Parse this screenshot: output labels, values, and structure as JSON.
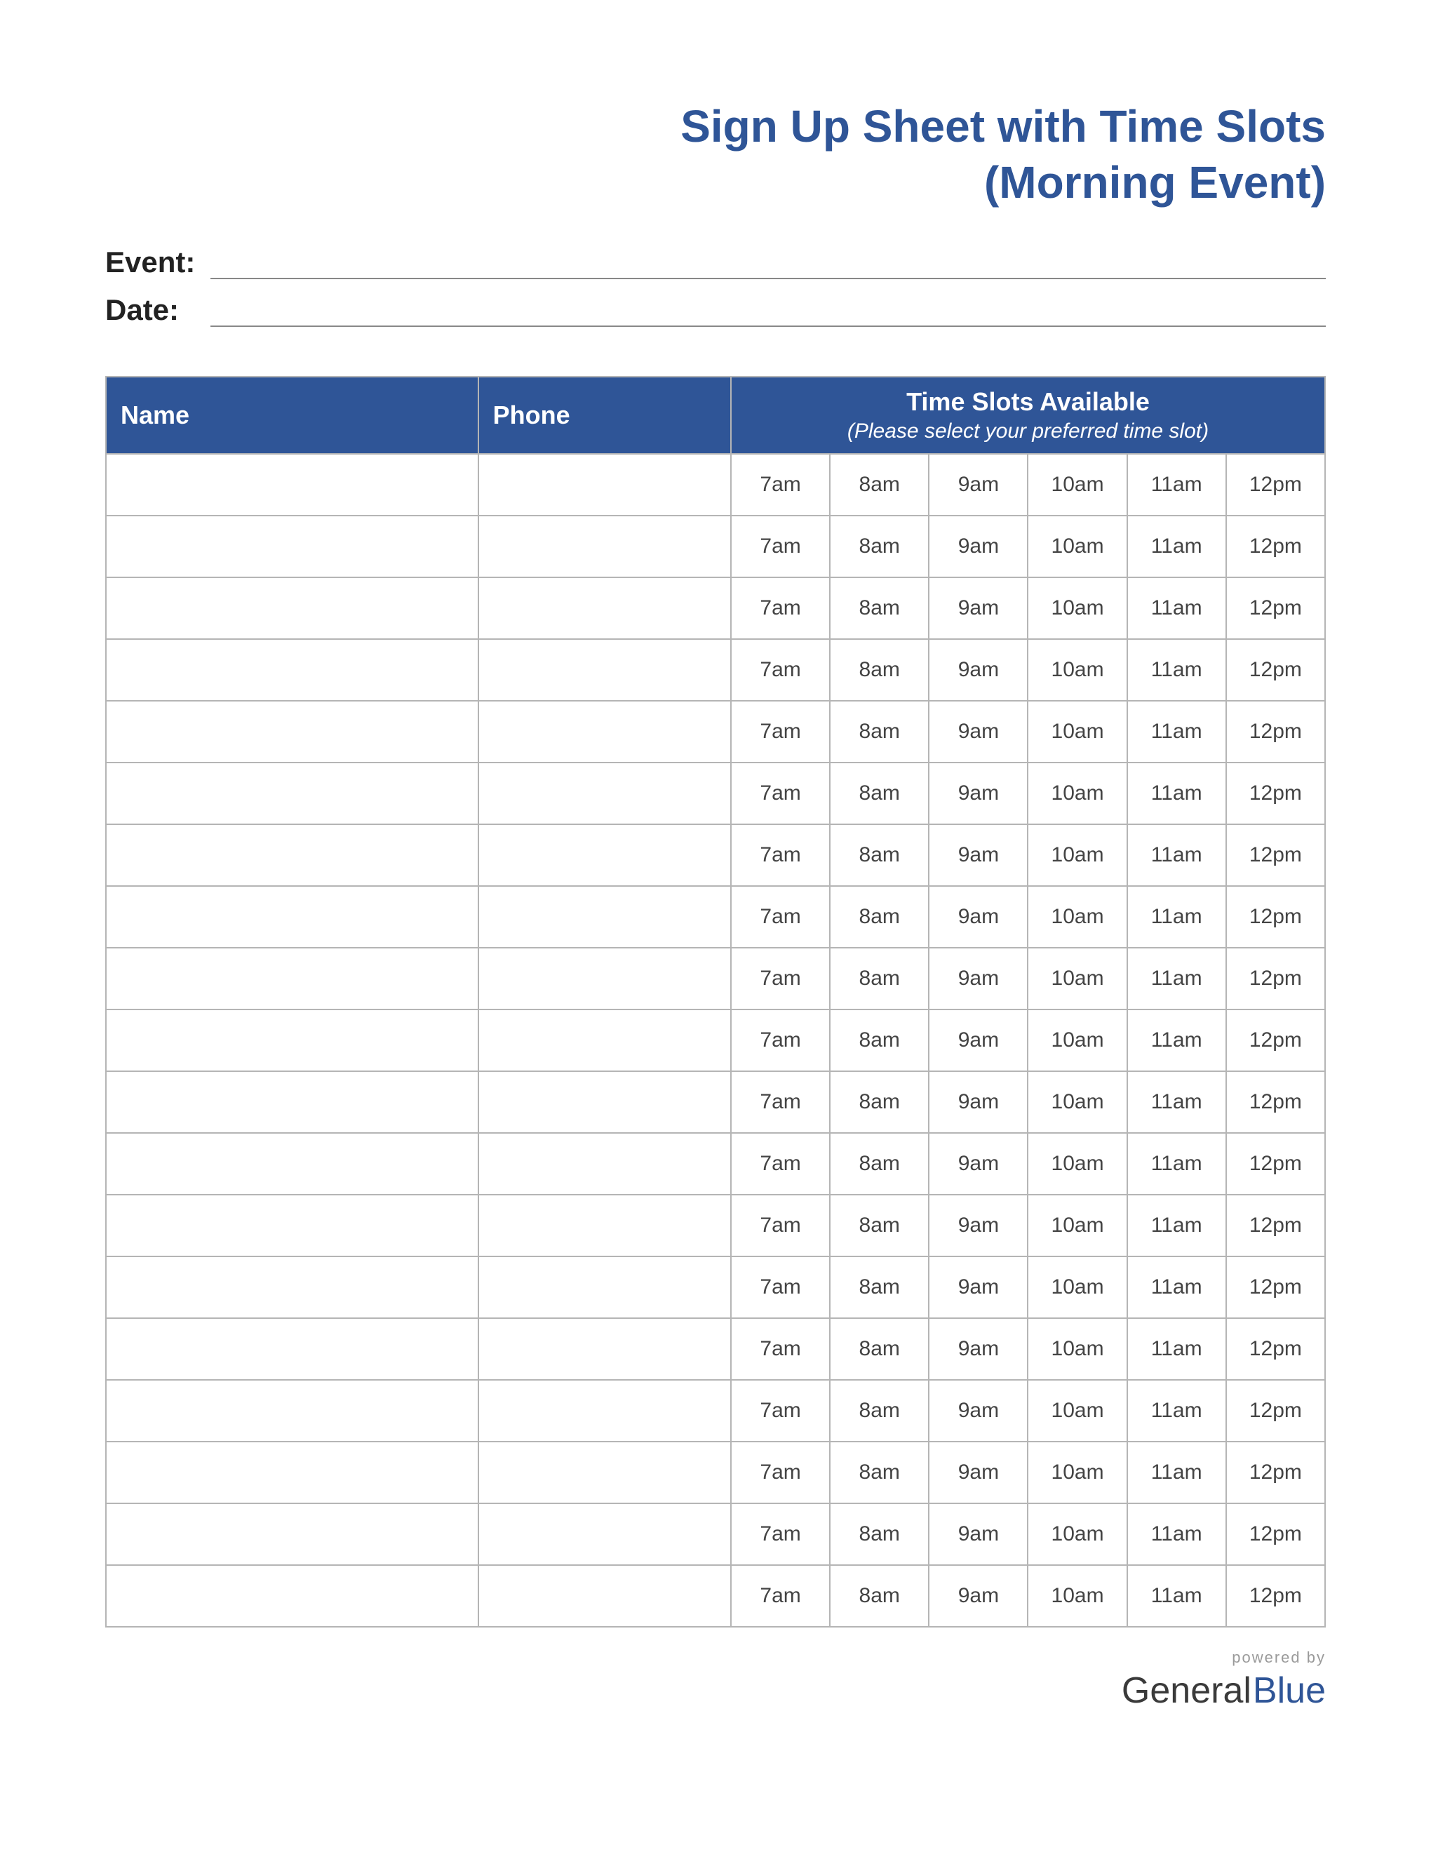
{
  "title_line1": "Sign Up Sheet with Time Slots",
  "title_line2": "(Morning Event)",
  "meta": {
    "event_label": "Event:",
    "event_value": "",
    "date_label": "Date:",
    "date_value": ""
  },
  "table": {
    "headers": {
      "name": "Name",
      "phone": "Phone",
      "timeslots_title": "Time Slots Available",
      "timeslots_subtitle": "(Please select your preferred time slot)"
    },
    "time_slots": [
      "7am",
      "8am",
      "9am",
      "10am",
      "11am",
      "12pm"
    ],
    "row_count": 19
  },
  "footer": {
    "powered_by": "powered by",
    "brand_part1": "General",
    "brand_part2": "Blue"
  },
  "colors": {
    "accent": "#2f5597",
    "border": "#b5b5b5"
  }
}
